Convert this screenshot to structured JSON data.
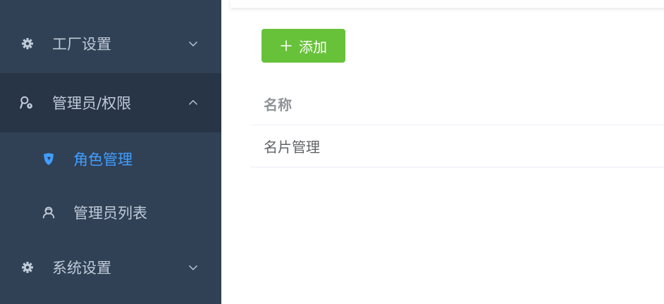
{
  "sidebar": {
    "items": [
      {
        "label": "工厂设置",
        "icon": "gear-icon",
        "expanded": false
      },
      {
        "label": "管理员/权限",
        "icon": "admin-key-icon",
        "expanded": true,
        "children": [
          {
            "label": "角色管理",
            "icon": "shield-icon",
            "active": true
          },
          {
            "label": "管理员列表",
            "icon": "users-icon",
            "active": false
          }
        ]
      },
      {
        "label": "系统设置",
        "icon": "gear-icon",
        "expanded": false
      }
    ],
    "colors": {
      "background": "#304156",
      "opened_background": "#283546",
      "text": "#bfcbd9",
      "active": "#409eff"
    }
  },
  "toolbar": {
    "add_label": "添加",
    "add_icon": "plus-icon",
    "add_color": "#67c23a"
  },
  "table": {
    "columns": [
      "名称"
    ],
    "rows": [
      [
        "名片管理"
      ]
    ]
  }
}
